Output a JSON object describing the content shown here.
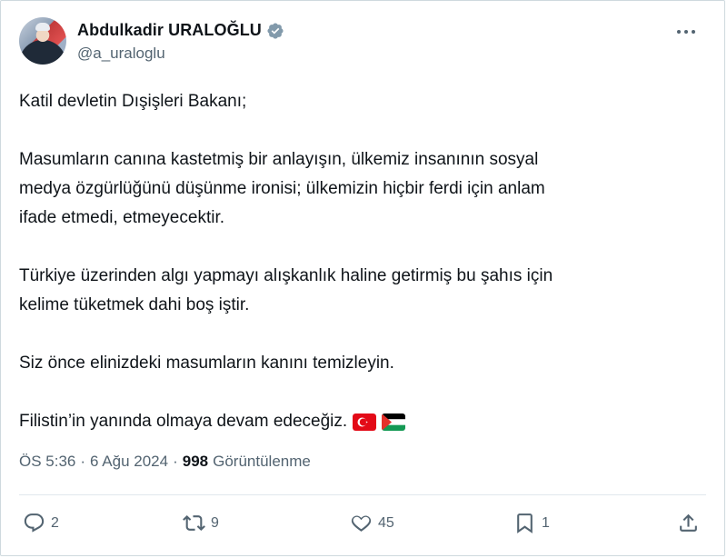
{
  "author": {
    "display_name": "Abdulkadir URALOĞLU",
    "handle": "@a_uraloglu",
    "verified": true
  },
  "tweet": {
    "paragraphs": [
      "Katil devletin Dışişleri Bakanı;",
      "Masumların canına kastetmiş bir anlayışın, ülkemiz insanının sosyal\nmedya özgürlüğünü düşünme ironisi; ülkemizin hiçbir ferdi için anlam\nifade etmedi, etmeyecektir.",
      "Türkiye üzerinden algı yapmayı alışkanlık haline getirmiş bu şahıs için\nkelime tüketmek dahi boş iştir.",
      "Siz önce elinizdeki masumların kanını temizleyin.",
      "Filistin’in yanında olmaya devam edeceğiz."
    ],
    "emoji": [
      "flag-turkey",
      "flag-palestine"
    ]
  },
  "meta": {
    "time": "ÖS 5:36",
    "separator": "·",
    "date": "6 Ağu 2024",
    "views_count": "998",
    "views_label": "Görüntülenme"
  },
  "actions": {
    "replies": "2",
    "retweets": "9",
    "likes": "45",
    "bookmarks": "1"
  },
  "colors": {
    "text": "#0f1419",
    "secondary": "#536471",
    "verified": "#829aab",
    "divider": "#e1e8ed"
  }
}
